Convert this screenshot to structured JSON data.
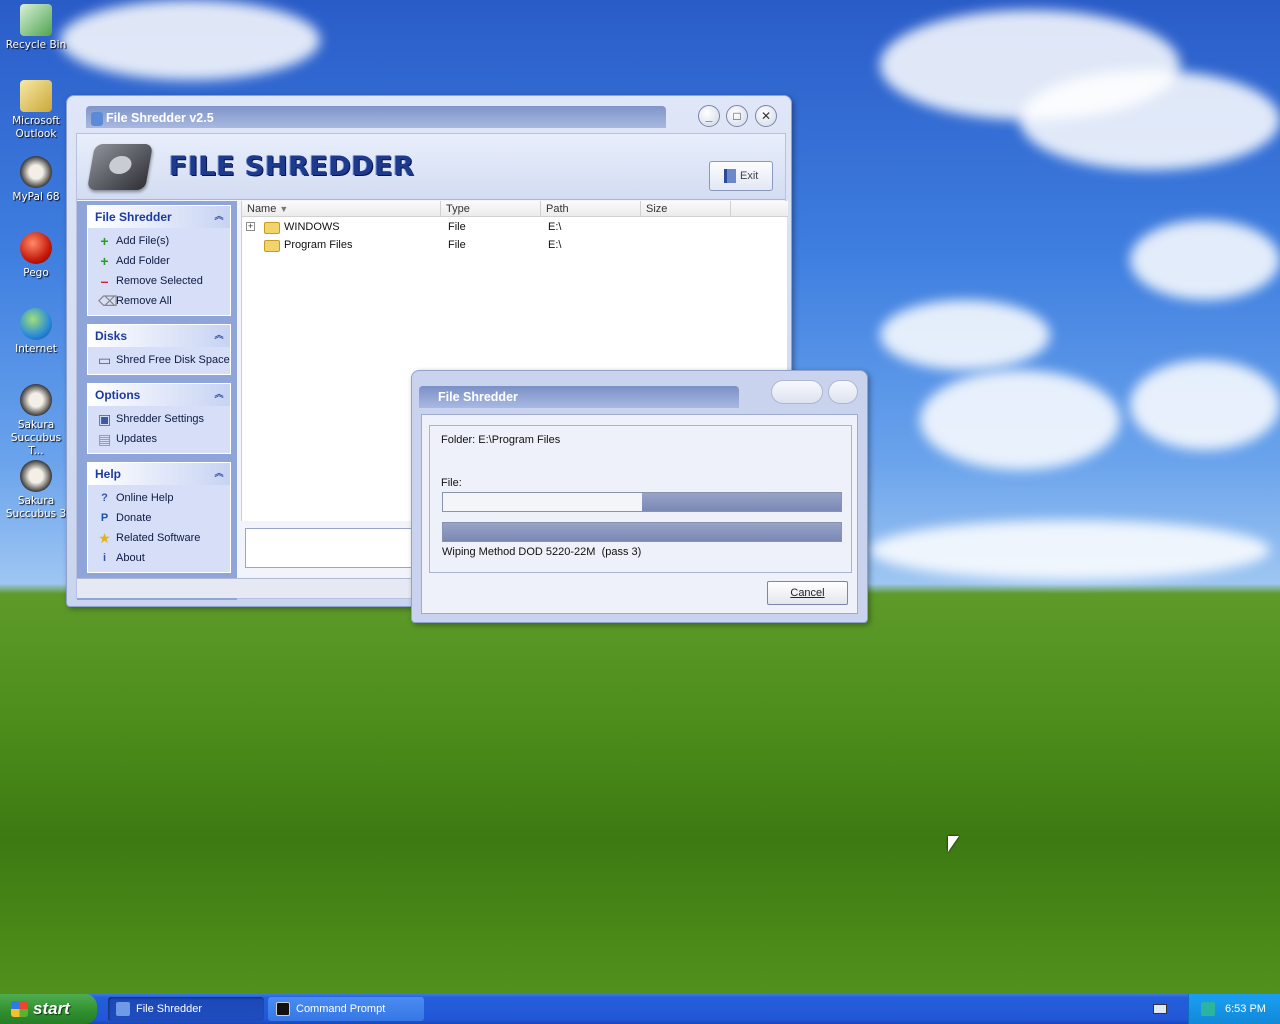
{
  "desktop": {
    "icons": [
      {
        "label": "Recycle Bin",
        "icon": "recycle-bin-icon"
      },
      {
        "label": "Microsoft Outlook",
        "icon": "outlook-icon"
      },
      {
        "label": "MyPal 68",
        "icon": "raccoon-icon"
      },
      {
        "label": "Pego",
        "icon": "red-ball-icon"
      },
      {
        "label": "Internet",
        "icon": "globe-icon"
      },
      {
        "label": "Sakura Succubus T...",
        "icon": "raccoon-icon"
      },
      {
        "label": "Sakura Succubus 3",
        "icon": "raccoon-icon"
      }
    ]
  },
  "main_window": {
    "title": "File Shredder v2.5",
    "logo_text": "FILE SHREDDER",
    "exit_label": "Exit",
    "minimize": "_",
    "maximize": "□",
    "close": "✕",
    "groups": {
      "file": {
        "title": "File Shredder",
        "items": [
          "Add File(s)",
          "Add Folder",
          "Remove Selected",
          "Remove All"
        ]
      },
      "disks": {
        "title": "Disks",
        "items": [
          "Shred Free Disk Space"
        ]
      },
      "options": {
        "title": "Options",
        "items": [
          "Shredder Settings",
          "Updates"
        ]
      },
      "help": {
        "title": "Help",
        "items": [
          "Online Help",
          "Donate",
          "Related Software",
          "About"
        ]
      }
    },
    "list": {
      "columns": [
        "Name",
        "Type",
        "Path",
        "Size"
      ],
      "rows": [
        {
          "name": "WINDOWS",
          "type": "File",
          "path": "E:\\",
          "size": "",
          "expander": "+"
        },
        {
          "name": "Program Files",
          "type": "File",
          "path": "E:\\",
          "size": ""
        }
      ]
    }
  },
  "progress_dialog": {
    "title": "File Shredder",
    "folder_text": "Folder: E:\\Program Files",
    "file_label": "File:",
    "file_progress": 0.5,
    "overall_progress": 1.0,
    "method_text": "Wiping Method DOD 5220-22M  (pass 3)",
    "cancel_label": "Cancel"
  },
  "taskbar": {
    "start_label": "start",
    "tasks": [
      {
        "label": "File Shredder",
        "icon": "file-shredder-icon"
      },
      {
        "label": "Command Prompt",
        "icon": "command-prompt-icon"
      }
    ],
    "clock": "6:53 PM"
  },
  "colors": {
    "accent": "#1c3aa0",
    "taskbar": "#245edb",
    "start": "#2f8f2f",
    "tray": "#1288d8"
  }
}
